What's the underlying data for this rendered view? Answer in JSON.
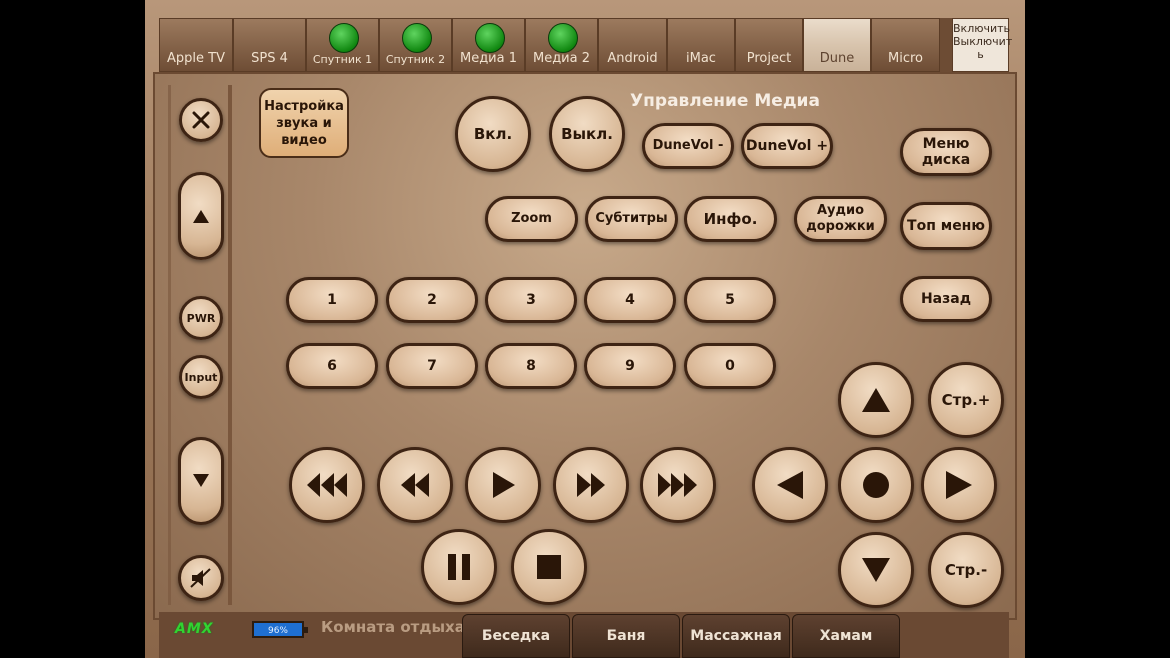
{
  "top_tabs": [
    {
      "label": "Apple TV",
      "indicator": false
    },
    {
      "label": "SPS 4",
      "indicator": false
    },
    {
      "label": "Спутник 1",
      "indicator": true
    },
    {
      "label": "Спутник 2",
      "indicator": true
    },
    {
      "label": "Медиа 1",
      "indicator": true
    },
    {
      "label": "Медиа 2",
      "indicator": true
    },
    {
      "label": "Android",
      "indicator": false
    },
    {
      "label": "iMac",
      "indicator": false
    },
    {
      "label": "Project",
      "indicator": false
    },
    {
      "label": "Dune",
      "indicator": false,
      "active": true
    },
    {
      "label": "Micro",
      "indicator": false
    }
  ],
  "power_toggle": {
    "line1": "Включить",
    "line2": "Выключит",
    "line3": "ь"
  },
  "left": {
    "pwr": "PWR",
    "input": "Input"
  },
  "setup_button": {
    "label": "Настройка звука и видео"
  },
  "title": "Управление Медиа",
  "buttons": {
    "on": "Вкл.",
    "off": "Выкл.",
    "vol_down": "DuneVol -",
    "vol_up": "DuneVol +",
    "disc_menu": "Меню диска",
    "zoom": "Zoom",
    "subtitles": "Субтитры",
    "info": "Инфо.",
    "audio_tracks": "Аудио дорожки",
    "top_menu": "Топ меню",
    "back": "Назад",
    "page_up": "Стр.+",
    "page_down": "Стр.-"
  },
  "digits_row1": [
    "1",
    "2",
    "3",
    "4",
    "5"
  ],
  "digits_row2": [
    "6",
    "7",
    "8",
    "9",
    "0"
  ],
  "bottom": {
    "logo": "AMX",
    "battery": "96%",
    "room": "Комната отдыха",
    "room_tabs": [
      "Беседка",
      "Баня",
      "Массажная",
      "Хамам"
    ]
  },
  "colors": {
    "indicator_green": "#118811",
    "battery_blue": "#1f6fd1",
    "logo_green": "#31d431"
  }
}
